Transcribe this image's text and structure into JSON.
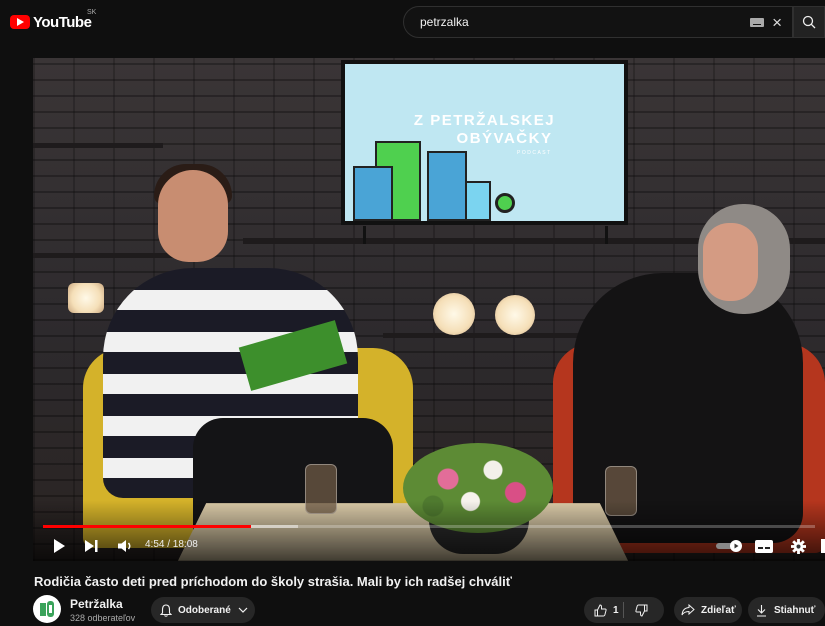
{
  "header": {
    "logo_text": "YouTube",
    "region": "SK",
    "search_value": "petrzalka"
  },
  "poster": {
    "title_line1": "Z PETRŽALSKEJ",
    "title_line2": "OBÝVAČKY",
    "subtitle": "PODCAST"
  },
  "player": {
    "time": "4:54 / 18:08",
    "played_fraction": 0.27,
    "buffered_fraction": 0.33
  },
  "video": {
    "title": "Rodičia často deti pred príchodom do školy strašia. Mali by ich radšej chváliť"
  },
  "channel": {
    "name": "Petržalka",
    "subscribers": "328 odberateľov"
  },
  "actions": {
    "subscribe_label": "Odoberané",
    "like_count": "1",
    "share_label": "Zdieľať",
    "download_label": "Stiahnuť"
  },
  "colors": {
    "accent": "#ff0000",
    "background": "#0f0f0f",
    "pill": "#272727"
  }
}
